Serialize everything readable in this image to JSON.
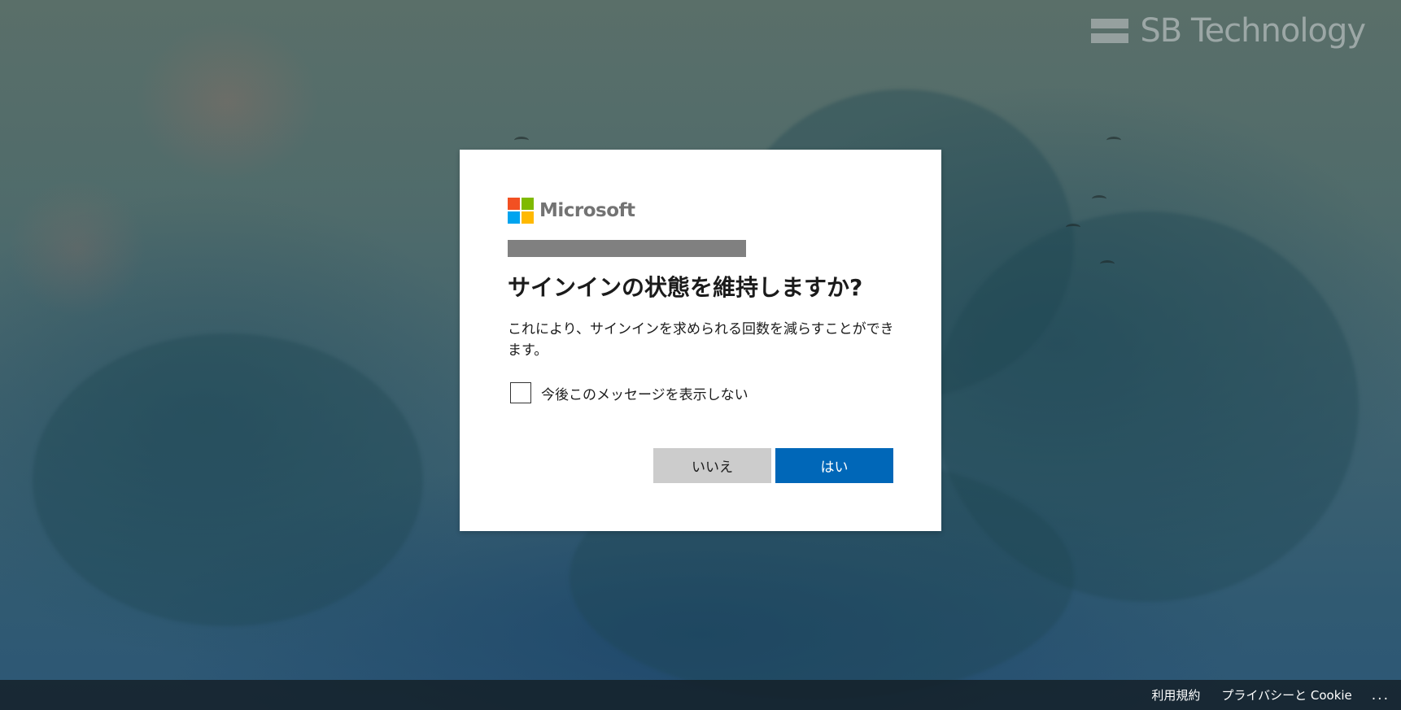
{
  "background": {
    "brand_logo_text": "SB Technology"
  },
  "dialog": {
    "logo": {
      "name": "Microsoft",
      "colors": [
        "#f25022",
        "#7fba00",
        "#00a4ef",
        "#ffb900"
      ]
    },
    "title": "サインインの状態を維持しますか?",
    "description": "これにより、サインインを求められる回数を減らすことができます。",
    "checkbox_label": "今後このメッセージを表示しない",
    "buttons": {
      "no_label": "いいえ",
      "yes_label": "はい"
    },
    "accent_color": "#0067b8"
  },
  "footer": {
    "terms_label": "利用規約",
    "privacy_label": "プライバシーと Cookie",
    "more_label": "..."
  }
}
